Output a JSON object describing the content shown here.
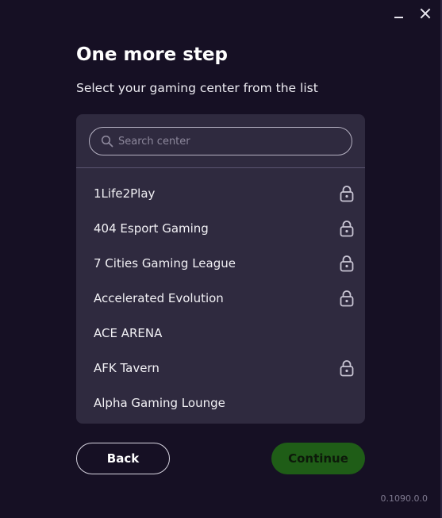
{
  "window": {
    "minimize_label": "minimize",
    "close_label": "close"
  },
  "header": {
    "title": "One more step",
    "subtitle": "Select your gaming center from the list"
  },
  "search": {
    "placeholder": "Search center",
    "value": ""
  },
  "centers": [
    {
      "name": "1Life2Play",
      "locked": true
    },
    {
      "name": "404 Esport Gaming",
      "locked": true
    },
    {
      "name": "7 Cities Gaming League",
      "locked": true
    },
    {
      "name": "Accelerated Evolution",
      "locked": true
    },
    {
      "name": "ACE ARENA",
      "locked": false
    },
    {
      "name": "AFK Tavern",
      "locked": true
    },
    {
      "name": "Alpha Gaming Lounge",
      "locked": false
    }
  ],
  "buttons": {
    "back_label": "Back",
    "continue_label": "Continue"
  },
  "footer": {
    "version": "0.1090.0.0"
  },
  "colors": {
    "background": "#161024",
    "panel": "#2f2a3f",
    "continue_bg": "#1f5d17"
  },
  "icons": {
    "search": "search-icon",
    "lock": "lock-icon"
  }
}
